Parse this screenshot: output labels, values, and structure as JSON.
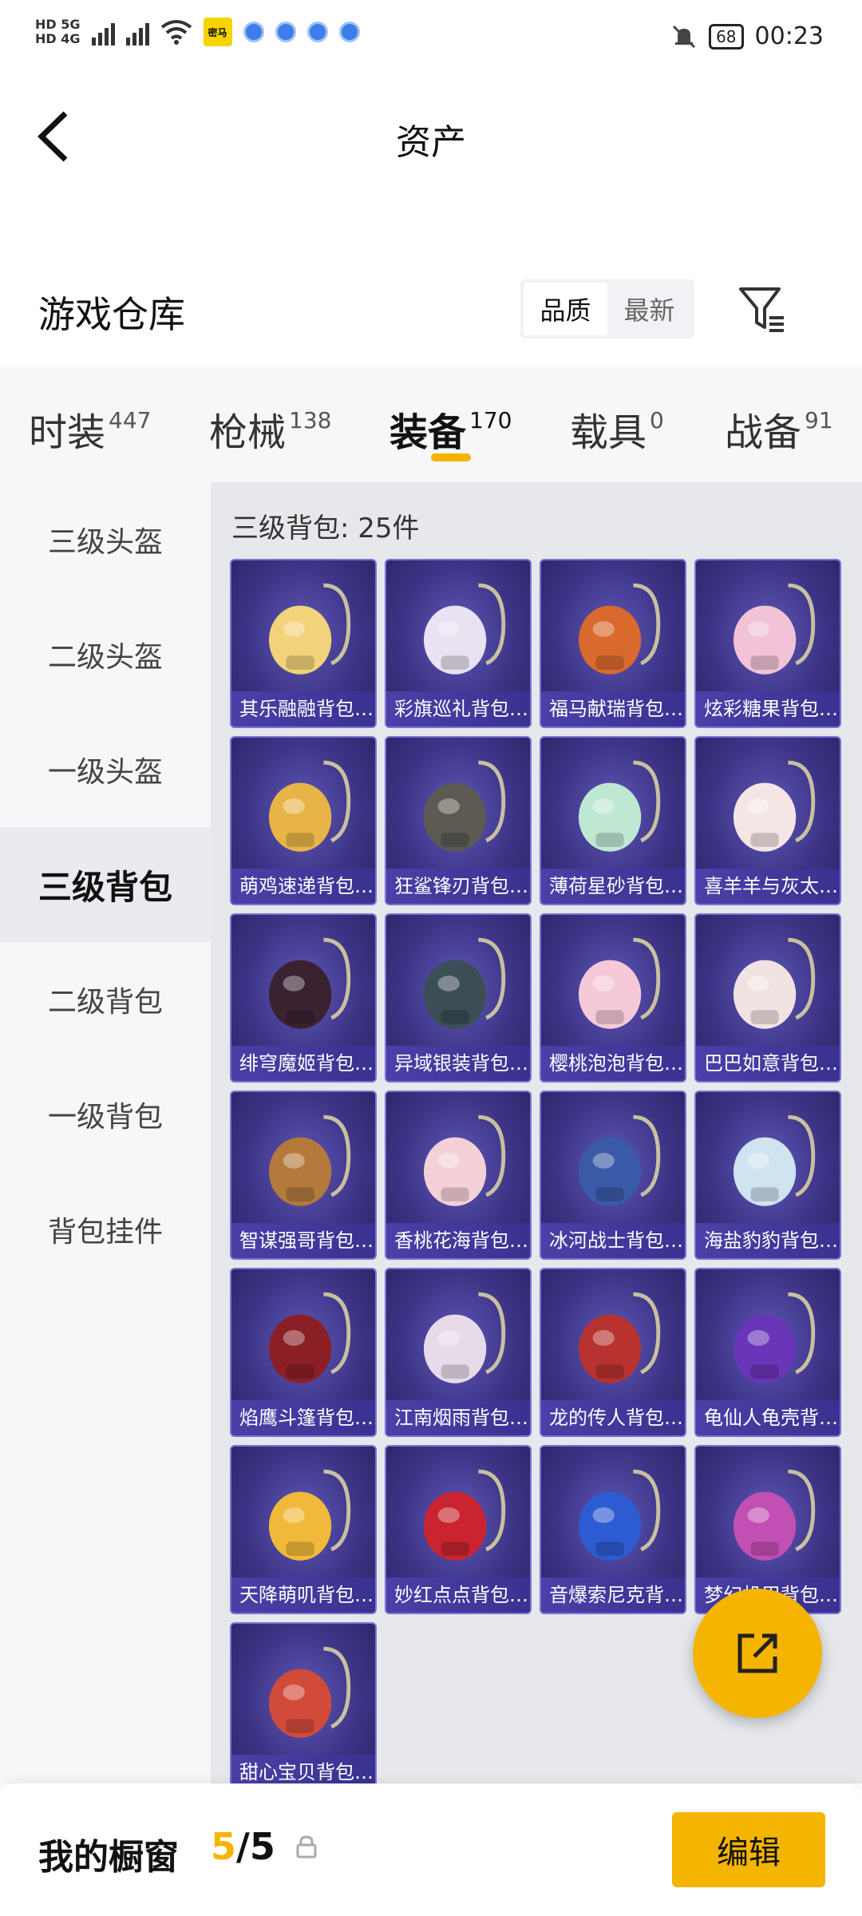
{
  "status_bar": {
    "network_small": "HD 5G",
    "network_small2": "HD 4G",
    "app_badge": "密马",
    "battery": "68",
    "time": "00:23"
  },
  "header": {
    "title": "资产"
  },
  "warehouse": {
    "title": "游戏仓库",
    "sort_options": [
      "品质",
      "最新"
    ],
    "active_sort": "品质"
  },
  "tabs": [
    {
      "label": "时装",
      "count": "447"
    },
    {
      "label": "枪械",
      "count": "138"
    },
    {
      "label": "装备",
      "count": "170"
    },
    {
      "label": "载具",
      "count": "0"
    },
    {
      "label": "战备",
      "count": "91"
    }
  ],
  "active_tab": "装备",
  "side_nav": [
    {
      "label": "三级头盔"
    },
    {
      "label": "二级头盔"
    },
    {
      "label": "一级头盔"
    },
    {
      "label": "三级背包"
    },
    {
      "label": "二级背包"
    },
    {
      "label": "一级背包"
    },
    {
      "label": "背包挂件"
    }
  ],
  "active_side": "三级背包",
  "content": {
    "count_label": "三级背包: 25件"
  },
  "items": [
    {
      "name": "其乐融融背包…",
      "color": "#f2d27a"
    },
    {
      "name": "彩旗巡礼背包…",
      "color": "#e9e2f2"
    },
    {
      "name": "福马献瑞背包…",
      "color": "#d9692d"
    },
    {
      "name": "炫彩糖果背包…",
      "color": "#f2c3d6"
    },
    {
      "name": "萌鸡速递背包…",
      "color": "#e8b447"
    },
    {
      "name": "狂鲨锋刃背包…",
      "color": "#5c5a52"
    },
    {
      "name": "薄荷星砂背包…",
      "color": "#bfe8d2"
    },
    {
      "name": "喜羊羊与灰太…",
      "color": "#f5e6e6"
    },
    {
      "name": "绯穹魔姬背包…",
      "color": "#3a2230"
    },
    {
      "name": "异域银装背包…",
      "color": "#3b4e55"
    },
    {
      "name": "樱桃泡泡背包…",
      "color": "#f5c9d8"
    },
    {
      "name": "巴巴如意背包…",
      "color": "#f2e3e3"
    },
    {
      "name": "智谋强哥背包…",
      "color": "#b37a3c"
    },
    {
      "name": "香桃花海背包…",
      "color": "#f4d0d7"
    },
    {
      "name": "冰河战士背包…",
      "color": "#3a5aa8"
    },
    {
      "name": "海盐豹豹背包…",
      "color": "#cfe3f0"
    },
    {
      "name": "焰鹰斗篷背包…",
      "color": "#8a1f25"
    },
    {
      "name": "江南烟雨背包…",
      "color": "#e8dbe9"
    },
    {
      "name": "龙的传人背包…",
      "color": "#b8322f"
    },
    {
      "name": "龟仙人龟壳背…",
      "color": "#6a35b8"
    },
    {
      "name": "天降萌叽背包…",
      "color": "#f0b93a"
    },
    {
      "name": "妙红点点背包…",
      "color": "#c9242f"
    },
    {
      "name": "音爆索尼克背…",
      "color": "#2d5bd1"
    },
    {
      "name": "梦幻机甲背包…",
      "color": "#c24fb3"
    },
    {
      "name": "甜心宝贝背包…",
      "color": "#d24b3a"
    }
  ],
  "bottom_bar": {
    "title": "我的橱窗",
    "used": "5",
    "separator": "/",
    "total": "5",
    "edit_label": "编辑"
  },
  "colors": {
    "accent": "#f5b400",
    "card_bg": "#3d3486",
    "card_label": "#4a40a8"
  }
}
